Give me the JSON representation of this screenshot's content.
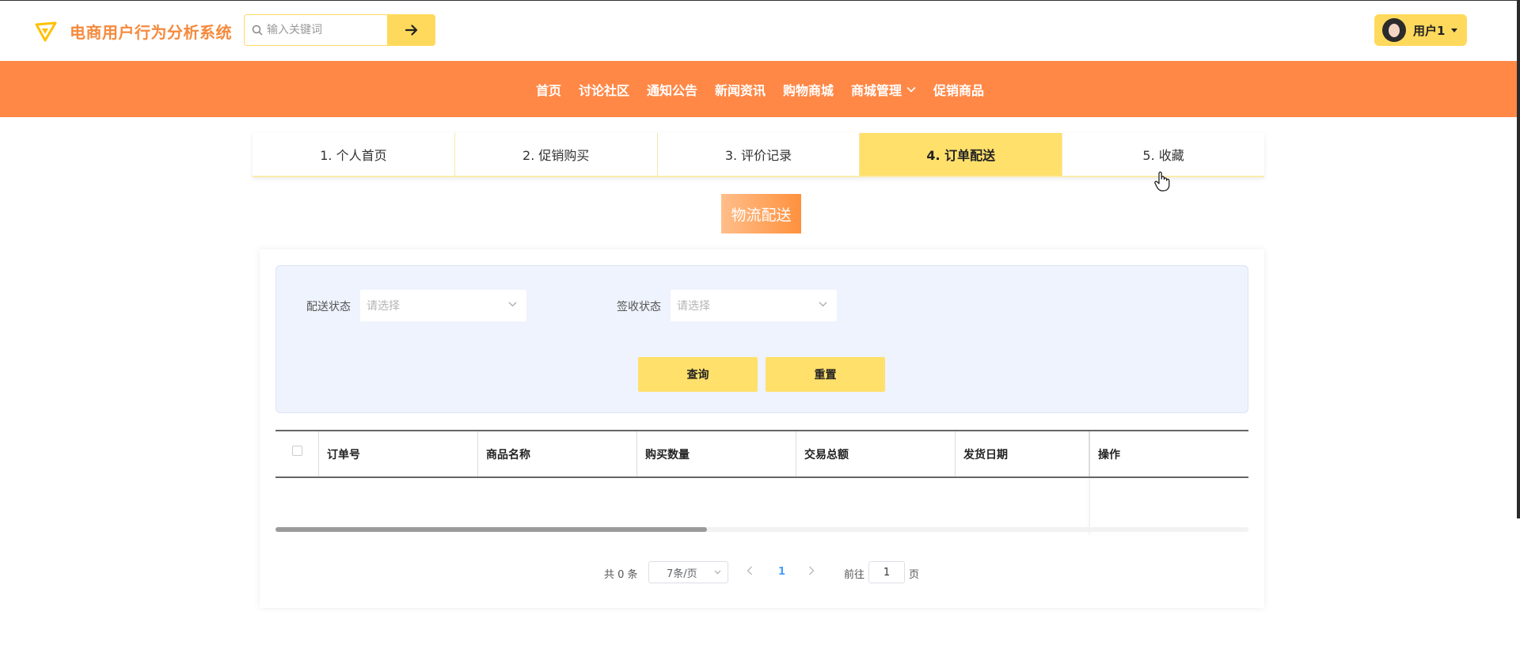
{
  "header": {
    "app_title": "电商用户行为分析系统",
    "search": {
      "placeholder": "输入关键词",
      "value": ""
    },
    "user_name": "用户1"
  },
  "nav": {
    "items": [
      {
        "label": "首页"
      },
      {
        "label": "讨论社区"
      },
      {
        "label": "通知公告"
      },
      {
        "label": "新闻资讯"
      },
      {
        "label": "购物商城"
      },
      {
        "label": "商城管理",
        "has_dropdown": true
      },
      {
        "label": "促销商品"
      }
    ]
  },
  "tabs": {
    "items": [
      {
        "label": "1. 个人首页"
      },
      {
        "label": "2. 促销购买"
      },
      {
        "label": "3. 评价记录"
      },
      {
        "label": "4. 订单配送"
      },
      {
        "label": "5. 收藏"
      }
    ],
    "active_index": 3
  },
  "section_title": "物流配送",
  "filter": {
    "delivery_status": {
      "label": "配送状态",
      "placeholder": "请选择"
    },
    "receipt_status": {
      "label": "签收状态",
      "placeholder": "请选择"
    },
    "query_label": "查询",
    "reset_label": "重置"
  },
  "table": {
    "columns": [
      "订单号",
      "商品名称",
      "购买数量",
      "交易总额",
      "发货日期",
      "操作"
    ],
    "rows": []
  },
  "pagination": {
    "total_text": "共 0 条",
    "page_size_text": "7条/页",
    "current_page": "1",
    "goto_label": "前往",
    "goto_value": "1",
    "page_suffix": "页"
  },
  "colors": {
    "nav_bg": "#ff8847",
    "accent_yellow": "#ffe06b",
    "logo_orange": "#f58a3d",
    "filter_bg": "#eef3fd"
  }
}
